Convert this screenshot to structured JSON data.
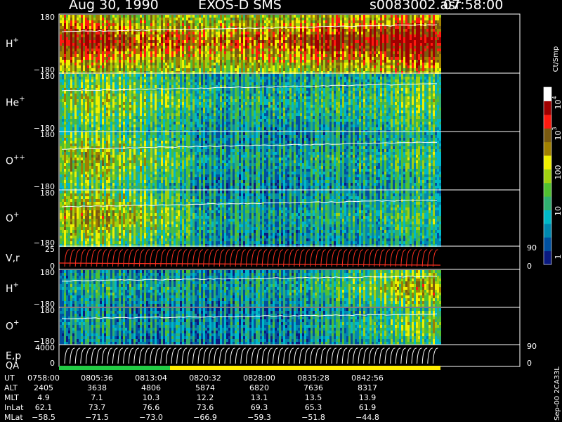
{
  "header": {
    "date": "Aug 30, 1990",
    "instrument": "EXOS-D SMS",
    "file": "s0083002.asr",
    "time": "07:58:00"
  },
  "colors": {
    "background": "#000000",
    "text": "#ffffff",
    "trace": "#ffffff",
    "vr_trace": "#ff3020",
    "qa_good": "#22cc44",
    "qa_fair": "#ffee00"
  },
  "chart_data": {
    "type": "heatmap",
    "panels": [
      {
        "label_main": "H",
        "label_sup": "+",
        "tick_top": "180",
        "tick_bottom": "−180",
        "kind": "spectrogram",
        "intensity_profile": [
          0.74,
          0.68,
          0.62,
          0.58,
          0.6,
          0.64,
          0.7,
          0.75,
          0.8
        ]
      },
      {
        "label_main": "He",
        "label_sup": "+",
        "tick_top": "180",
        "tick_bottom": "−180",
        "kind": "spectrogram",
        "intensity_profile": [
          0.38,
          0.4,
          0.34,
          0.22,
          0.2,
          0.22,
          0.24,
          0.3,
          0.36
        ]
      },
      {
        "label_main": "O",
        "label_sup": "++",
        "tick_top": "180",
        "tick_bottom": "−180",
        "kind": "spectrogram",
        "intensity_profile": [
          0.46,
          0.42,
          0.34,
          0.18,
          0.16,
          0.18,
          0.2,
          0.24,
          0.3
        ]
      },
      {
        "label_main": "O",
        "label_sup": "+",
        "tick_top": "180",
        "tick_bottom": "−180",
        "kind": "spectrogram",
        "intensity_profile": [
          0.52,
          0.48,
          0.38,
          0.2,
          0.16,
          0.18,
          0.2,
          0.24,
          0.28
        ]
      },
      {
        "label_main": "V,r",
        "label_sup": "",
        "tick_top": "25",
        "tick_bottom": "0",
        "right_top": "90",
        "right_bottom": "0",
        "kind": "line"
      },
      {
        "label_main": "H",
        "label_sup": "+",
        "tick_top": "180",
        "tick_bottom": "−180",
        "kind": "spectrogram",
        "intensity_profile": [
          0.18,
          0.2,
          0.18,
          0.16,
          0.16,
          0.2,
          0.28,
          0.42,
          0.55
        ]
      },
      {
        "label_main": "O",
        "label_sup": "+",
        "tick_top": "180",
        "tick_bottom": "−180",
        "kind": "spectrogram",
        "intensity_profile": [
          0.16,
          0.16,
          0.14,
          0.12,
          0.12,
          0.14,
          0.2,
          0.3,
          0.42
        ]
      },
      {
        "label_main": "E,p",
        "label_sup": "",
        "tick_top": "4000",
        "tick_bottom": "0",
        "right_top": "90",
        "right_bottom": "0",
        "kind": "line"
      }
    ],
    "qa_label": "QA",
    "colorbar": {
      "unit": "Ct/Smp",
      "ticks": [
        {
          "base": "10",
          "exp": "4",
          "value": 10000
        },
        {
          "base": "10",
          "exp": "3",
          "value": 1000
        },
        {
          "base": "100",
          "exp": "",
          "value": 100
        },
        {
          "base": "10",
          "exp": "",
          "value": 10
        },
        {
          "base": "1",
          "exp": "",
          "value": 1
        }
      ],
      "stops": [
        "#0a1a80",
        "#0050a0",
        "#0088b0",
        "#00b8c8",
        "#30b070",
        "#50c030",
        "#a0d010",
        "#f0f000",
        "#a08000",
        "#7a5a10",
        "#ff1a10",
        "#a00000",
        "#ffffff"
      ]
    },
    "time_axis": {
      "row_labels": [
        "UT",
        "ALT",
        "MLT",
        "InLat",
        "MLat"
      ],
      "columns": [
        {
          "UT": "0758:00",
          "ALT": "2405",
          "MLT": "4.9",
          "InLat": "62.1",
          "MLat": "−58.5"
        },
        {
          "UT": "0805:36",
          "ALT": "3638",
          "MLT": "7.1",
          "InLat": "73.7",
          "MLat": "−71.5"
        },
        {
          "UT": "0813:04",
          "ALT": "4806",
          "MLT": "10.3",
          "InLat": "76.6",
          "MLat": "−73.0"
        },
        {
          "UT": "0820:32",
          "ALT": "5874",
          "MLT": "12.2",
          "InLat": "73.6",
          "MLat": "−66.9"
        },
        {
          "UT": "0828:00",
          "ALT": "6820",
          "MLT": "13.1",
          "InLat": "69.3",
          "MLat": "−59.3"
        },
        {
          "UT": "0835:28",
          "ALT": "7636",
          "MLT": "13.5",
          "InLat": "65.3",
          "MLat": "−51.8"
        },
        {
          "UT": "0842:56",
          "ALT": "8317",
          "MLT": "13.9",
          "InLat": "61.9",
          "MLat": "−44.8"
        }
      ]
    },
    "footer_note": "Sep-00 2CA33L"
  }
}
